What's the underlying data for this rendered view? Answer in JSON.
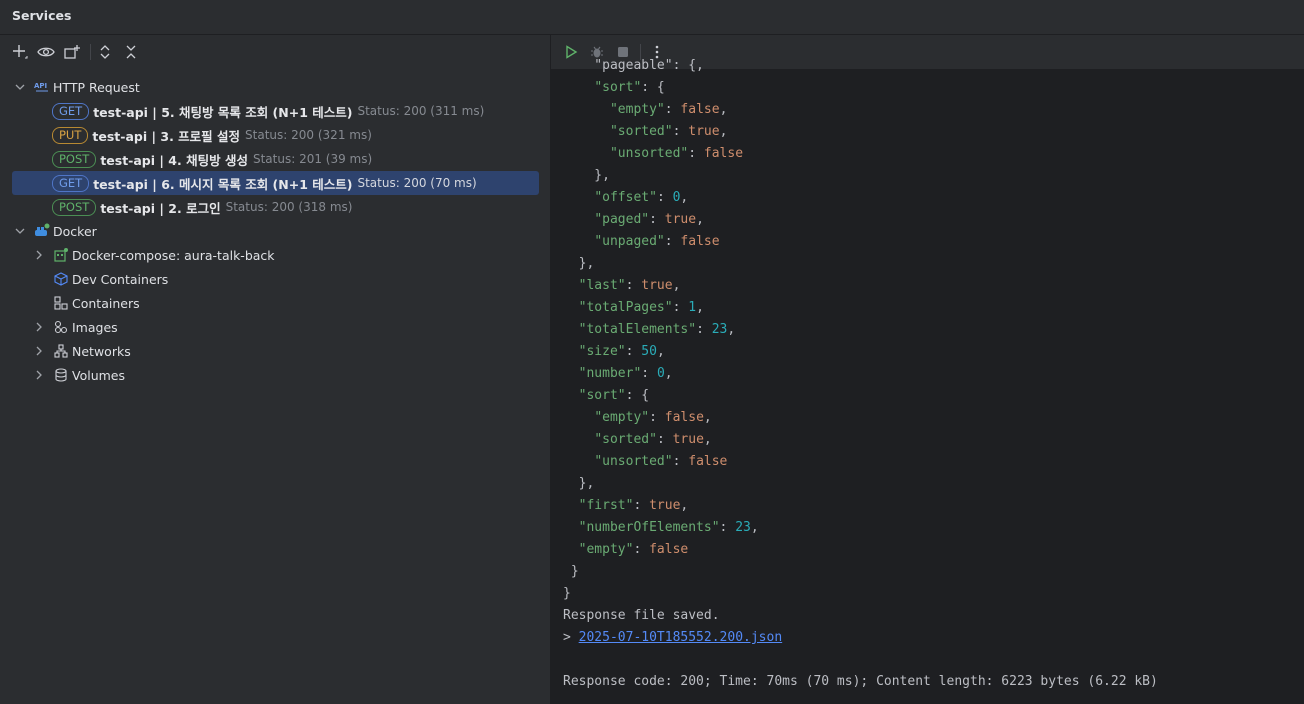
{
  "title": "Services",
  "tree": {
    "http_request_label": "HTTP Request",
    "requests": [
      {
        "method": "GET",
        "name": "test-api  |  5. 채팅방 목록 조회 (N+1 테스트)",
        "status": "Status: 200 (311 ms)"
      },
      {
        "method": "PUT",
        "name": "test-api  |  3. 프로필 설정",
        "status": "Status: 200 (321 ms)"
      },
      {
        "method": "POST",
        "name": "test-api  |  4. 채팅방 생성",
        "status": "Status: 201 (39 ms)"
      },
      {
        "method": "GET",
        "name": "test-api  |  6. 메시지 목록 조회 (N+1 테스트)",
        "status": "Status: 200 (70 ms)"
      },
      {
        "method": "POST",
        "name": "test-api  |  2. 로그인",
        "status": "Status: 200 (318 ms)"
      }
    ],
    "docker_label": "Docker",
    "docker_items": [
      {
        "label": "Docker-compose: aura-talk-back"
      },
      {
        "label": "Dev Containers"
      },
      {
        "label": "Containers"
      },
      {
        "label": "Images"
      },
      {
        "label": "Networks"
      },
      {
        "label": "Volumes"
      }
    ]
  },
  "output": {
    "lines": [
      [
        {
          "t": "p",
          "s": "    \"pageable\": {,"
        }
      ],
      [
        {
          "t": "p",
          "s": "    "
        },
        {
          "t": "k",
          "s": "\"sort\""
        },
        {
          "t": "p",
          "s": ": {"
        }
      ],
      [
        {
          "t": "p",
          "s": "      "
        },
        {
          "t": "k",
          "s": "\"empty\""
        },
        {
          "t": "p",
          "s": ": "
        },
        {
          "t": "v",
          "s": "false"
        },
        {
          "t": "p",
          "s": ","
        }
      ],
      [
        {
          "t": "p",
          "s": "      "
        },
        {
          "t": "k",
          "s": "\"sorted\""
        },
        {
          "t": "p",
          "s": ": "
        },
        {
          "t": "v",
          "s": "true"
        },
        {
          "t": "p",
          "s": ","
        }
      ],
      [
        {
          "t": "p",
          "s": "      "
        },
        {
          "t": "k",
          "s": "\"unsorted\""
        },
        {
          "t": "p",
          "s": ": "
        },
        {
          "t": "v",
          "s": "false"
        }
      ],
      [
        {
          "t": "p",
          "s": "    },"
        }
      ],
      [
        {
          "t": "p",
          "s": "    "
        },
        {
          "t": "k",
          "s": "\"offset\""
        },
        {
          "t": "p",
          "s": ": "
        },
        {
          "t": "n",
          "s": "0"
        },
        {
          "t": "p",
          "s": ","
        }
      ],
      [
        {
          "t": "p",
          "s": "    "
        },
        {
          "t": "k",
          "s": "\"paged\""
        },
        {
          "t": "p",
          "s": ": "
        },
        {
          "t": "v",
          "s": "true"
        },
        {
          "t": "p",
          "s": ","
        }
      ],
      [
        {
          "t": "p",
          "s": "    "
        },
        {
          "t": "k",
          "s": "\"unpaged\""
        },
        {
          "t": "p",
          "s": ": "
        },
        {
          "t": "v",
          "s": "false"
        }
      ],
      [
        {
          "t": "p",
          "s": "  },"
        }
      ],
      [
        {
          "t": "p",
          "s": "  "
        },
        {
          "t": "k",
          "s": "\"last\""
        },
        {
          "t": "p",
          "s": ": "
        },
        {
          "t": "v",
          "s": "true"
        },
        {
          "t": "p",
          "s": ","
        }
      ],
      [
        {
          "t": "p",
          "s": "  "
        },
        {
          "t": "k",
          "s": "\"totalPages\""
        },
        {
          "t": "p",
          "s": ": "
        },
        {
          "t": "n",
          "s": "1"
        },
        {
          "t": "p",
          "s": ","
        }
      ],
      [
        {
          "t": "p",
          "s": "  "
        },
        {
          "t": "k",
          "s": "\"totalElements\""
        },
        {
          "t": "p",
          "s": ": "
        },
        {
          "t": "n",
          "s": "23"
        },
        {
          "t": "p",
          "s": ","
        }
      ],
      [
        {
          "t": "p",
          "s": "  "
        },
        {
          "t": "k",
          "s": "\"size\""
        },
        {
          "t": "p",
          "s": ": "
        },
        {
          "t": "n",
          "s": "50"
        },
        {
          "t": "p",
          "s": ","
        }
      ],
      [
        {
          "t": "p",
          "s": "  "
        },
        {
          "t": "k",
          "s": "\"number\""
        },
        {
          "t": "p",
          "s": ": "
        },
        {
          "t": "n",
          "s": "0"
        },
        {
          "t": "p",
          "s": ","
        }
      ],
      [
        {
          "t": "p",
          "s": "  "
        },
        {
          "t": "k",
          "s": "\"sort\""
        },
        {
          "t": "p",
          "s": ": {"
        }
      ],
      [
        {
          "t": "p",
          "s": "    "
        },
        {
          "t": "k",
          "s": "\"empty\""
        },
        {
          "t": "p",
          "s": ": "
        },
        {
          "t": "v",
          "s": "false"
        },
        {
          "t": "p",
          "s": ","
        }
      ],
      [
        {
          "t": "p",
          "s": "    "
        },
        {
          "t": "k",
          "s": "\"sorted\""
        },
        {
          "t": "p",
          "s": ": "
        },
        {
          "t": "v",
          "s": "true"
        },
        {
          "t": "p",
          "s": ","
        }
      ],
      [
        {
          "t": "p",
          "s": "    "
        },
        {
          "t": "k",
          "s": "\"unsorted\""
        },
        {
          "t": "p",
          "s": ": "
        },
        {
          "t": "v",
          "s": "false"
        }
      ],
      [
        {
          "t": "p",
          "s": "  },"
        }
      ],
      [
        {
          "t": "p",
          "s": "  "
        },
        {
          "t": "k",
          "s": "\"first\""
        },
        {
          "t": "p",
          "s": ": "
        },
        {
          "t": "v",
          "s": "true"
        },
        {
          "t": "p",
          "s": ","
        }
      ],
      [
        {
          "t": "p",
          "s": "  "
        },
        {
          "t": "k",
          "s": "\"numberOfElements\""
        },
        {
          "t": "p",
          "s": ": "
        },
        {
          "t": "n",
          "s": "23"
        },
        {
          "t": "p",
          "s": ","
        }
      ],
      [
        {
          "t": "p",
          "s": "  "
        },
        {
          "t": "k",
          "s": "\"empty\""
        },
        {
          "t": "p",
          "s": ": "
        },
        {
          "t": "v",
          "s": "false"
        }
      ],
      [
        {
          "t": "p",
          "s": " }"
        }
      ],
      [
        {
          "t": "p",
          "s": "}"
        }
      ],
      [
        {
          "t": "p",
          "s": "Response file saved."
        }
      ],
      [
        {
          "t": "p",
          "s": "> "
        },
        {
          "t": "link",
          "s": "2025-07-10T185552.200.json"
        }
      ],
      [
        {
          "t": "p",
          "s": ""
        }
      ],
      [
        {
          "t": "p",
          "s": "Response code: 200; Time: 70ms (70 ms); Content length: 6223 bytes (6.22 kB)"
        }
      ]
    ]
  },
  "colors": {
    "get": "#6f9bea",
    "put": "#d9a343",
    "post": "#5fb26a",
    "selected": "#2e436e",
    "key": "#6aab73",
    "keyword": "#cf8e6d",
    "number": "#2aacb8"
  },
  "icons": {
    "toolbar": [
      "add-service-icon",
      "eye-icon",
      "new-group-icon",
      "expand-all-icon",
      "collapse-all-icon"
    ],
    "run_toolbar": [
      "run-icon",
      "debug-icon",
      "stop-icon",
      "more-icon"
    ]
  }
}
